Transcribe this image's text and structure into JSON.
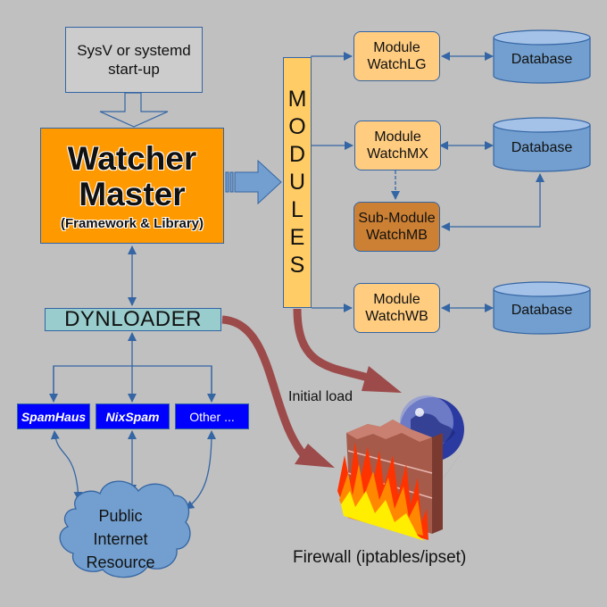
{
  "startup": {
    "line1": "SysV or systemd",
    "line2": "start-up"
  },
  "master": {
    "line1": "Watcher",
    "line2": "Master",
    "line3": "(Framework & Library)"
  },
  "modules_bar": {
    "letters": [
      "M",
      "O",
      "D",
      "U",
      "L",
      "E",
      "S"
    ]
  },
  "modules": [
    {
      "line1": "Module",
      "line2": "WatchLG"
    },
    {
      "line1": "Module",
      "line2": "WatchMX"
    },
    {
      "line1": "Sub-Module",
      "line2": "WatchMB"
    },
    {
      "line1": "Module",
      "line2": "WatchWB"
    }
  ],
  "databases": [
    {
      "label": "Database"
    },
    {
      "label": "Database"
    },
    {
      "label": "Database"
    }
  ],
  "dynloader": {
    "label": "DYNLOADER"
  },
  "sources": [
    {
      "label": "SpamHaus"
    },
    {
      "label": "NixSpam"
    },
    {
      "label": "Other ..."
    }
  ],
  "cloud": {
    "line1": "Public",
    "line2": "Internet",
    "line3": "Resource"
  },
  "initial_load": {
    "label": "Initial load"
  },
  "firewall": {
    "label": "Firewall (iptables/ipset)"
  },
  "colors": {
    "background": "#c0c0c0",
    "master": "#ff9900",
    "modules_bar": "#ffcc66",
    "module": "#ffcc80",
    "submodule": "#cc8033",
    "database": "#729fcf",
    "dynloader": "#99cccc",
    "source": "#0000ff",
    "connector": "#3465a4",
    "load_arrow": "#9c4a4a"
  }
}
